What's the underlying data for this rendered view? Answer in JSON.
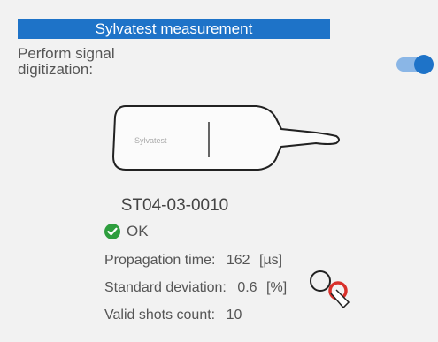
{
  "header": {
    "title": "Sylvatest measurement"
  },
  "signal": {
    "label": "Perform signal digitization:",
    "enabled": true
  },
  "device": {
    "brand": "Sylvatest",
    "serial": "ST04-03-0010"
  },
  "status": {
    "text": "OK"
  },
  "results": {
    "propagation_time": {
      "label": "Propagation time:",
      "value": "162",
      "unit": "[µs]"
    },
    "standard_deviation": {
      "label": "Standard deviation:",
      "value": "0.6",
      "unit": "[%]"
    },
    "valid_shots": {
      "label": "Valid shots count:",
      "value": "10"
    }
  },
  "colors": {
    "accent": "#1e73c8",
    "ok_green": "#2e9e3e",
    "magnifier_red": "#d9312b"
  },
  "icons": {
    "status": "check-circle-icon",
    "details": "magnifier-icon"
  }
}
